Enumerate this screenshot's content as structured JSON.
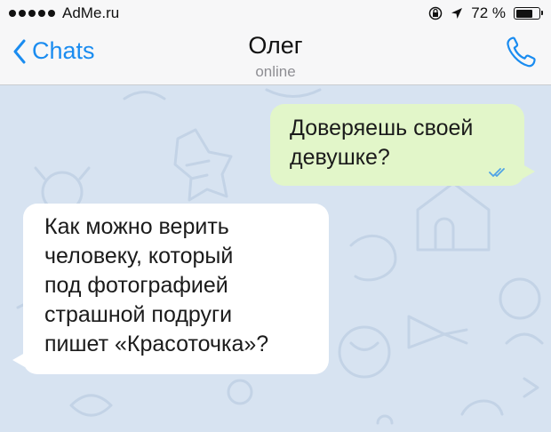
{
  "status_bar": {
    "carrier": "AdMe.ru",
    "battery": "72 %",
    "battery_level": 0.72,
    "icons": [
      "signal-dots-icon",
      "lock-rotation-icon",
      "location-arrow-icon",
      "battery-icon"
    ]
  },
  "nav": {
    "back_label": "Chats",
    "title": "Олег",
    "subtitle": "online",
    "icons": [
      "chevron-left-icon",
      "phone-icon"
    ]
  },
  "messages": [
    {
      "direction": "outgoing",
      "lines": [
        "Доверяешь своей",
        "девушке?"
      ],
      "status_icon": "double-check-icon"
    },
    {
      "direction": "incoming",
      "lines": [
        "Как можно верить",
        "человеку, который",
        "под фотографией",
        "страшной подруги",
        "пишет «Красоточка»?"
      ]
    }
  ],
  "colors": {
    "accent": "#1a8cf0",
    "chat_background": "#d7e3f1",
    "outgoing_bubble": "#e2f6c9",
    "incoming_bubble": "#ffffff",
    "read_ticks": "#4fa3e6"
  }
}
